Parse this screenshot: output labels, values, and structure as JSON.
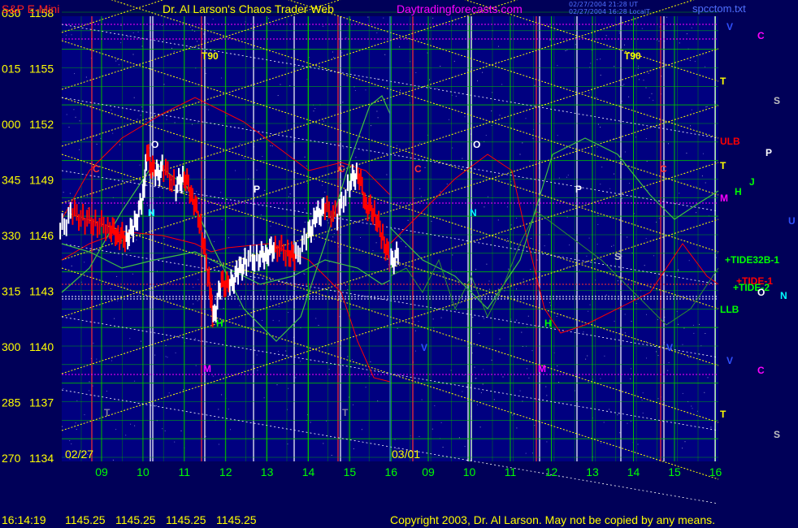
{
  "header": {
    "symbol": "S&P E-Mini",
    "author": "Dr. Al Larson's Chaos Trader Web",
    "site": "Daytradingforecasts.com",
    "stamp1": "02/27/2004 21:28 UT",
    "stamp2": "02/27/2004 16:28 LocalT",
    "file": "spcctom.txt"
  },
  "footer": {
    "time": "16:14:19",
    "quotes": [
      "1145.25",
      "1145.25",
      "1145.25",
      "1145.25"
    ],
    "copyright": "Copyright 2003, Dr. Al Larson. May not be copied by any means."
  },
  "colors": {
    "background": "#000058",
    "plot_area": "#000080",
    "grid": "#00c000",
    "yellow": "#ffff00",
    "magenta": "#ff00ff",
    "red": "#ff0000",
    "white": "#ffffff",
    "cyan": "#00ffff",
    "green_text": "#00ff00"
  },
  "chart_data": {
    "type": "bar",
    "title": "S&P E-Mini",
    "ylim": [
      1134,
      1158
    ],
    "y_ticks": [
      {
        "angle": "270",
        "price": "1134"
      },
      {
        "angle": "285",
        "price": "1137"
      },
      {
        "angle": "300",
        "price": "1140"
      },
      {
        "angle": "315",
        "price": "1143"
      },
      {
        "angle": "330",
        "price": "1146"
      },
      {
        "angle": "345",
        "price": "1149"
      },
      {
        "angle": "000",
        "price": "1152"
      },
      {
        "angle": "015",
        "price": "1155"
      },
      {
        "angle": "030",
        "price": "1158"
      }
    ],
    "date_labels": [
      "02/27",
      "03/01"
    ],
    "x_ticks": [
      "09",
      "10",
      "11",
      "12",
      "13",
      "14",
      "15",
      "16",
      "09",
      "10",
      "11",
      "12",
      "13",
      "14",
      "15",
      "16"
    ],
    "price_path": [
      [
        8.0,
        1146.2
      ],
      [
        8.3,
        1147.2
      ],
      [
        8.6,
        1146.8
      ],
      [
        8.9,
        1146.6
      ],
      [
        9.2,
        1146.4
      ],
      [
        9.4,
        1146.0
      ],
      [
        9.6,
        1145.8
      ],
      [
        9.8,
        1146.5
      ],
      [
        10.0,
        1148.0
      ],
      [
        10.1,
        1150.3
      ],
      [
        10.3,
        1149.2
      ],
      [
        10.5,
        1149.6
      ],
      [
        10.8,
        1148.6
      ],
      [
        11.0,
        1149.2
      ],
      [
        11.2,
        1148.1
      ],
      [
        11.4,
        1146.5
      ],
      [
        11.6,
        1143.5
      ],
      [
        11.7,
        1141.4
      ],
      [
        11.9,
        1143.4
      ],
      [
        12.1,
        1143.2
      ],
      [
        12.3,
        1144.0
      ],
      [
        12.5,
        1144.6
      ],
      [
        12.8,
        1144.8
      ],
      [
        13.0,
        1145.0
      ],
      [
        13.2,
        1145.4
      ],
      [
        13.5,
        1145.0
      ],
      [
        13.7,
        1144.8
      ],
      [
        14.0,
        1146.0
      ],
      [
        14.2,
        1147.0
      ],
      [
        14.4,
        1147.4
      ],
      [
        14.7,
        1147.0
      ],
      [
        15.0,
        1148.8
      ],
      [
        15.2,
        1149.4
      ],
      [
        15.4,
        1147.6
      ],
      [
        15.6,
        1147.2
      ],
      [
        15.8,
        1145.8
      ],
      [
        16.0,
        1144.5
      ],
      [
        16.2,
        1145.0
      ]
    ],
    "annotations": {
      "t90": "T90",
      "c": "C",
      "o": "O",
      "n": "N",
      "p": "P",
      "h": "H",
      "m": "M",
      "t": "T",
      "v": "V",
      "s": "S",
      "j": "J",
      "u": "U",
      "ulb": "ULB",
      "llb": "LLB",
      "tide32b": "+TIDE32B-1",
      "tide1": "+TIDE-1",
      "tide2": "+TIDE-2"
    }
  }
}
